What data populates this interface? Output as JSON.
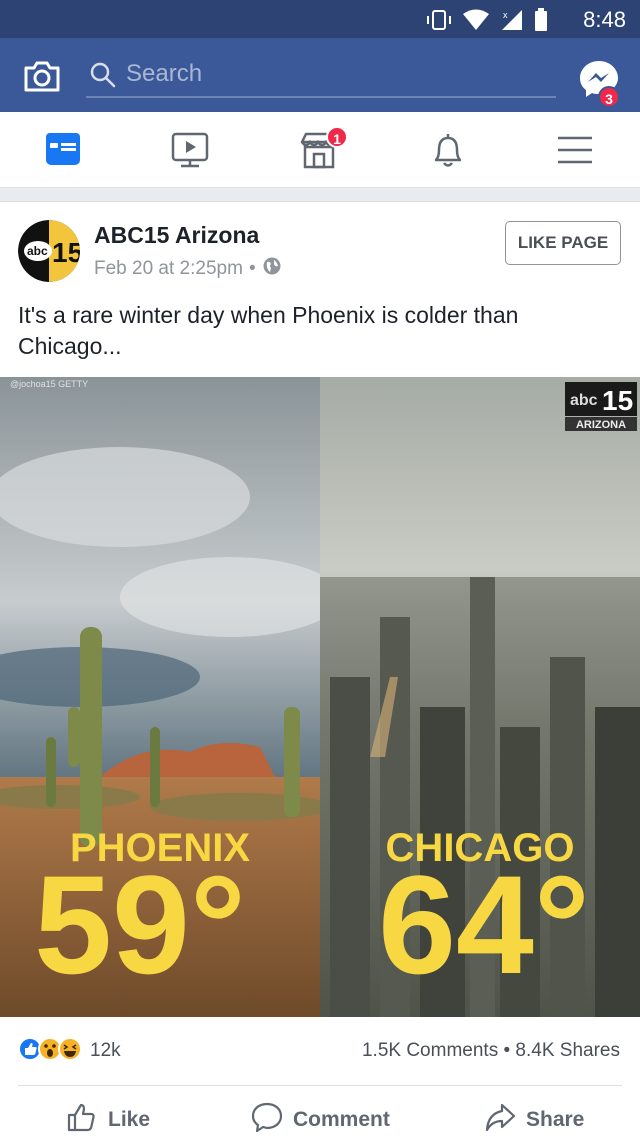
{
  "status_bar": {
    "time": "8:48",
    "icons": [
      "vibrate-icon",
      "wifi-icon",
      "signal-icon",
      "battery-icon"
    ]
  },
  "top_bar": {
    "search_placeholder": "Search",
    "messenger_badge": "3",
    "icons": [
      "camera-icon",
      "search-icon",
      "messenger-icon"
    ]
  },
  "nav": {
    "items": [
      {
        "name": "news-feed",
        "icon": "news-feed-icon",
        "active": true
      },
      {
        "name": "watch",
        "icon": "video-icon"
      },
      {
        "name": "marketplace",
        "icon": "marketplace-icon",
        "badge": "1"
      },
      {
        "name": "notifications",
        "icon": "bell-icon"
      },
      {
        "name": "menu",
        "icon": "hamburger-icon"
      }
    ]
  },
  "post": {
    "page_name": "ABC15 Arizona",
    "timestamp": "Feb 20 at 2:25pm",
    "separator": "•",
    "like_page_label": "LIKE PAGE",
    "text": "It's a rare winter day when Phoenix is colder than Chicago...",
    "image": {
      "credit": "@jochoa15 GETTY",
      "logo_text": "abc",
      "logo_number": "15",
      "logo_sub": "ARIZONA",
      "left_city": "PHOENIX",
      "left_temp": "59°",
      "right_city": "CHICAGO",
      "right_temp": "64°"
    },
    "reactions_count": "12k",
    "comments": "1.5K Comments",
    "shares": "8.4K Shares",
    "dot": "•",
    "actions": {
      "like": "Like",
      "comment": "Comment",
      "share": "Share"
    }
  },
  "colors": {
    "brand_blue": "#3b5998",
    "status_bar": "#2d4373",
    "badge_red": "#f02849",
    "temp_yellow": "#f7d842"
  }
}
